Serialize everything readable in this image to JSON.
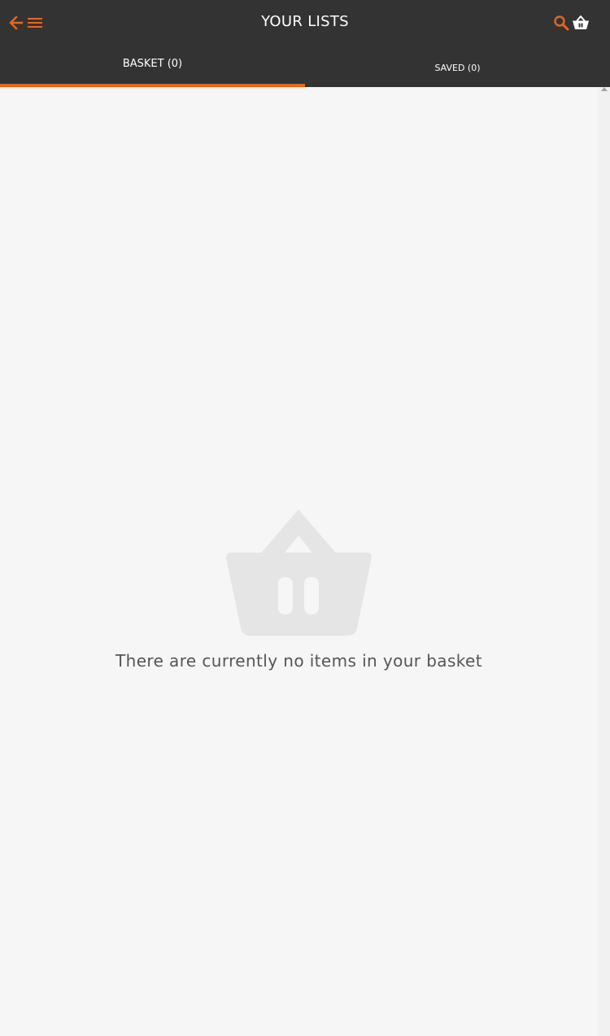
{
  "header": {
    "title": "YOUR LISTS",
    "back_icon": "arrow-left-icon",
    "menu_icon": "hamburger-menu-icon",
    "search_icon": "search-icon",
    "basket_icon": "basket-icon"
  },
  "tabs": [
    {
      "label": "BASKET (0)",
      "active": true
    },
    {
      "label": "SAVED (0)",
      "active": false
    }
  ],
  "empty_state": {
    "icon": "basket-icon",
    "message": "There are currently no items in your basket"
  },
  "colors": {
    "header_bg": "#333333",
    "accent": "#e8661d",
    "page_bg": "#f6f6f6",
    "empty_icon": "#e5e5e5",
    "empty_text": "#555555"
  }
}
